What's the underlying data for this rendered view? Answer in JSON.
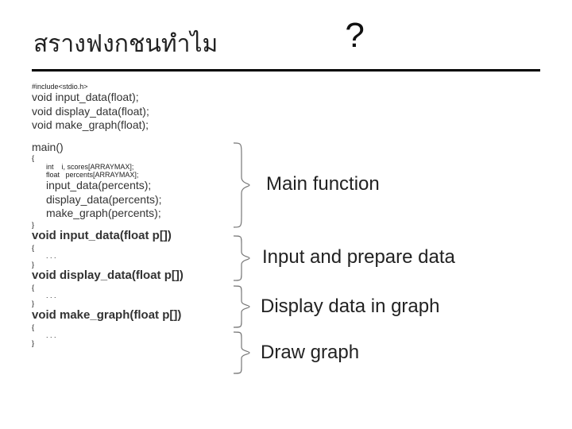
{
  "title": {
    "left": "สรางฟงกชนทำไม",
    "right": "?"
  },
  "code": {
    "include": "#include<stdio.h>",
    "protos": [
      "void input_data(float);",
      "void display_data(float);",
      "void make_graph(float);"
    ],
    "main_sig": "main()",
    "brace_open": "{",
    "decl1_kw": "int",
    "decl1_rest": "i, scores[ARRAYMAX];",
    "decl2_kw": "float",
    "decl2_rest": "percents[ARRAYMAX];",
    "main_body": [
      "input_data(percents);",
      "display_data(percents);",
      "make_graph(percents);"
    ],
    "brace_close": "}",
    "fn1_sig": "void input_data(float p[])",
    "fn2_sig": "void display_data(float p[])",
    "fn3_sig": "void make_graph(float p[])",
    "stub_open": "{",
    "stub_body": ". . .",
    "stub_close": "}"
  },
  "labels": {
    "main": "Main function",
    "input": "Input and prepare data",
    "display": "Display data in graph",
    "draw": "Draw graph"
  }
}
